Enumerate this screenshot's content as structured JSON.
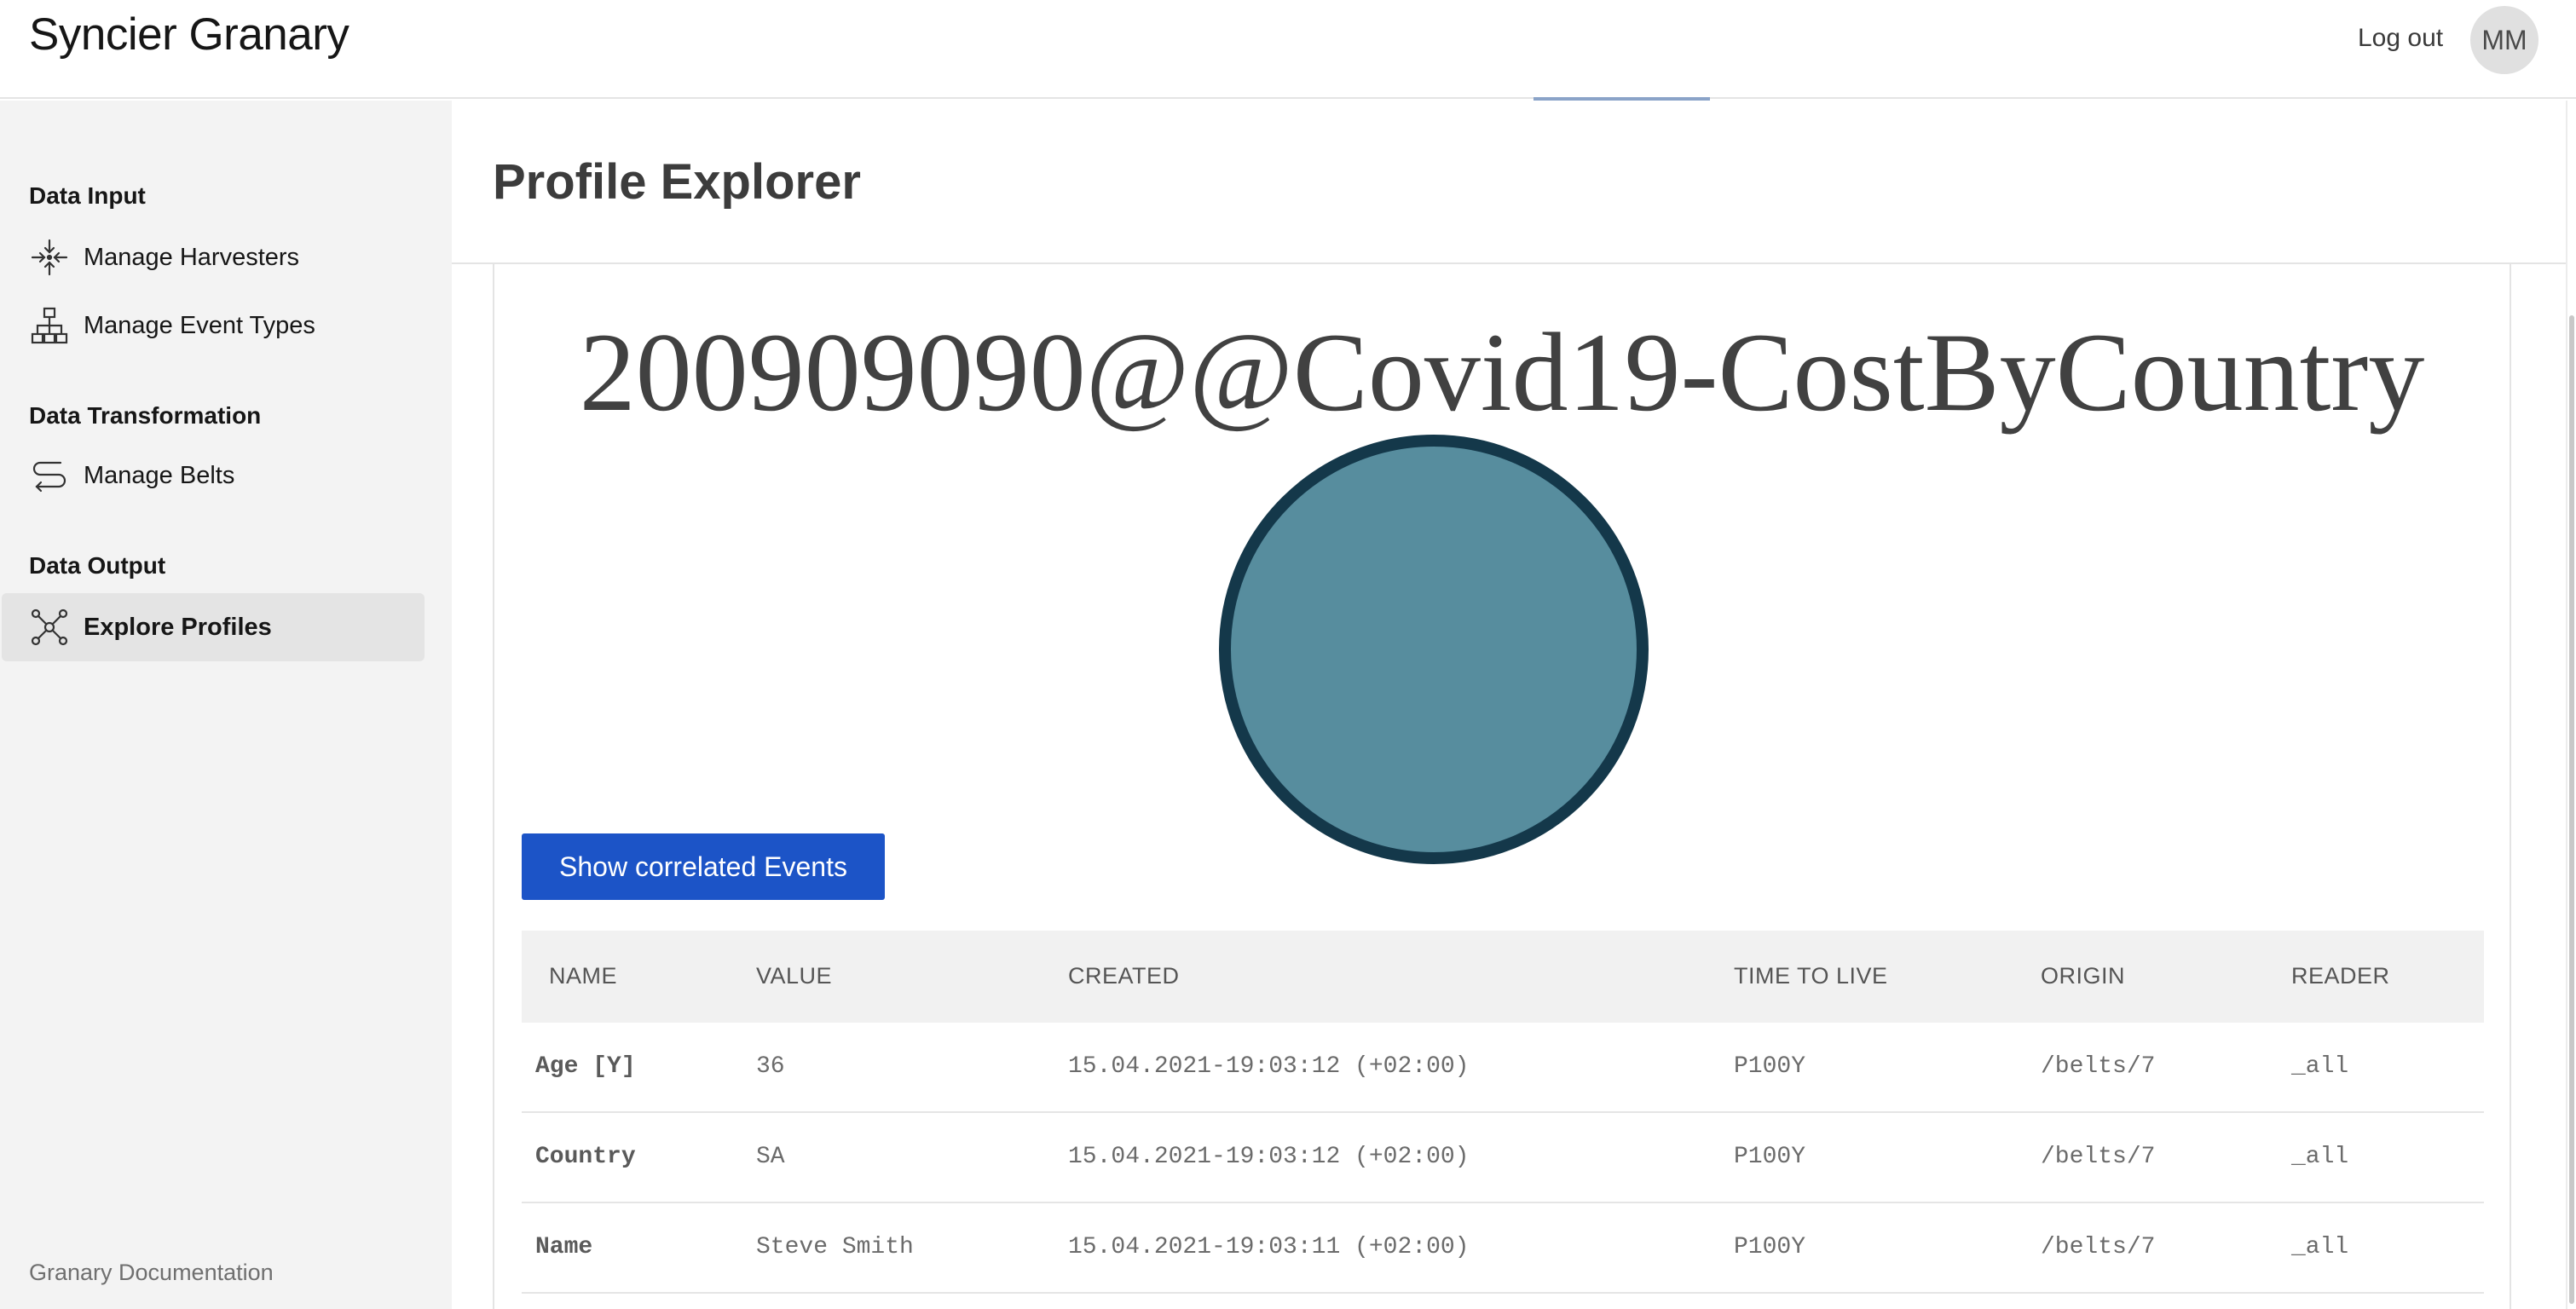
{
  "header": {
    "app_title": "Syncier Granary",
    "logout_label": "Log out",
    "avatar_initials": "MM"
  },
  "sidebar": {
    "sections": [
      {
        "heading": "Data Input",
        "items": [
          {
            "label": "Manage Harvesters",
            "icon": "harvester-icon",
            "active": false
          },
          {
            "label": "Manage Event Types",
            "icon": "hierarchy-icon",
            "active": false
          }
        ]
      },
      {
        "heading": "Data Transformation",
        "items": [
          {
            "label": "Manage Belts",
            "icon": "belt-route-icon",
            "active": false
          }
        ]
      },
      {
        "heading": "Data Output",
        "items": [
          {
            "label": "Explore Profiles",
            "icon": "network-icon",
            "active": true
          }
        ]
      }
    ],
    "footer_link": "Granary Documentation"
  },
  "main": {
    "page_title": "Profile Explorer",
    "profile_id": "200909090@@Covid19-CostByCountry",
    "show_events_button": "Show correlated Events",
    "colors": {
      "button": "#1c54c7",
      "circle_fill": "#578d9e",
      "circle_border": "#14384a"
    },
    "table": {
      "columns": [
        "NAME",
        "VALUE",
        "CREATED",
        "TIME TO LIVE",
        "ORIGIN",
        "READER"
      ],
      "rows": [
        {
          "name": "Age [Y]",
          "value": "36",
          "created": "15.04.2021-19:03:12 (+02:00)",
          "ttl": "P100Y",
          "origin": "/belts/7",
          "reader": "_all"
        },
        {
          "name": "Country",
          "value": "SA",
          "created": "15.04.2021-19:03:12 (+02:00)",
          "ttl": "P100Y",
          "origin": "/belts/7",
          "reader": "_all"
        },
        {
          "name": "Name",
          "value": "Steve Smith",
          "created": "15.04.2021-19:03:11 (+02:00)",
          "ttl": "P100Y",
          "origin": "/belts/7",
          "reader": "_all"
        }
      ]
    }
  }
}
